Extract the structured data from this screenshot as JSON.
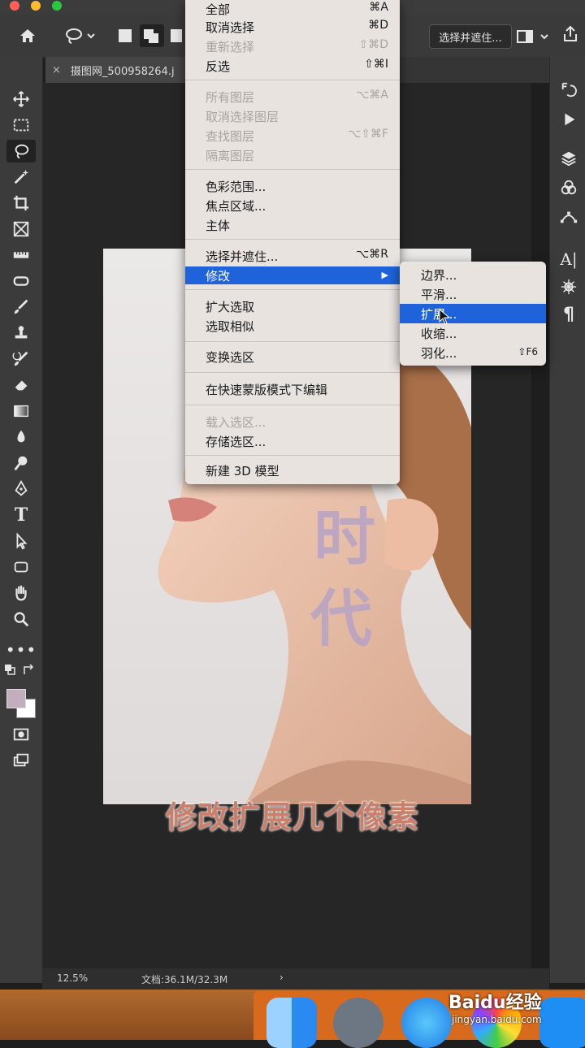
{
  "options_bar": {
    "select_and_mask_button": "选择并遮住..."
  },
  "document_tab": {
    "title": "摄图网_500958264.j"
  },
  "status_bar": {
    "zoom": "12.5%",
    "doc_info": "文档:36.1M/32.3M",
    "arrow": "›"
  },
  "menu": {
    "items": [
      {
        "label": "全部",
        "shortcut": "⌘A",
        "disabled": false
      },
      {
        "label": "取消选择",
        "shortcut": "⌘D",
        "disabled": false
      },
      {
        "label": "重新选择",
        "shortcut": "⇧⌘D",
        "disabled": true
      },
      {
        "label": "反选",
        "shortcut": "⇧⌘I",
        "disabled": false
      },
      {
        "label": "所有图层",
        "shortcut": "⌥⌘A",
        "disabled": true
      },
      {
        "label": "取消选择图层",
        "shortcut": "",
        "disabled": true
      },
      {
        "label": "查找图层",
        "shortcut": "⌥⇧⌘F",
        "disabled": true
      },
      {
        "label": "隔离图层",
        "shortcut": "",
        "disabled": true
      },
      {
        "label": "色彩范围...",
        "shortcut": "",
        "disabled": false
      },
      {
        "label": "焦点区域...",
        "shortcut": "",
        "disabled": false
      },
      {
        "label": "主体",
        "shortcut": "",
        "disabled": false
      },
      {
        "label": "选择并遮住...",
        "shortcut": "⌥⌘R",
        "disabled": false
      },
      {
        "label": "修改",
        "shortcut": "▶",
        "disabled": false,
        "highlighted": true
      },
      {
        "label": "扩大选取",
        "shortcut": "",
        "disabled": false
      },
      {
        "label": "选取相似",
        "shortcut": "",
        "disabled": false
      },
      {
        "label": "变换选区",
        "shortcut": "",
        "disabled": false
      },
      {
        "label": "在快速蒙版模式下编辑",
        "shortcut": "",
        "disabled": false
      },
      {
        "label": "载入选区...",
        "shortcut": "",
        "disabled": true
      },
      {
        "label": "存储选区...",
        "shortcut": "",
        "disabled": false
      },
      {
        "label": "新建 3D 模型",
        "shortcut": "",
        "disabled": false
      }
    ]
  },
  "submenu": {
    "items": [
      {
        "label": "边界...",
        "shortcut": ""
      },
      {
        "label": "平滑...",
        "shortcut": ""
      },
      {
        "label": "扩展...",
        "shortcut": "",
        "highlighted": true
      },
      {
        "label": "收缩...",
        "shortcut": ""
      },
      {
        "label": "羽化...",
        "shortcut": "⇧F6"
      }
    ]
  },
  "canvas_text": {
    "line1": "时",
    "line2": "代"
  },
  "subtitle": "修改扩展几个像素",
  "watermark": {
    "brand": "Baidu经验",
    "url": "jingyan.baidu.com"
  },
  "colors": {
    "menu_highlight": "#1e63d9",
    "subtitle": "#c97f6a",
    "selection_fill": "#b9a4c4"
  }
}
